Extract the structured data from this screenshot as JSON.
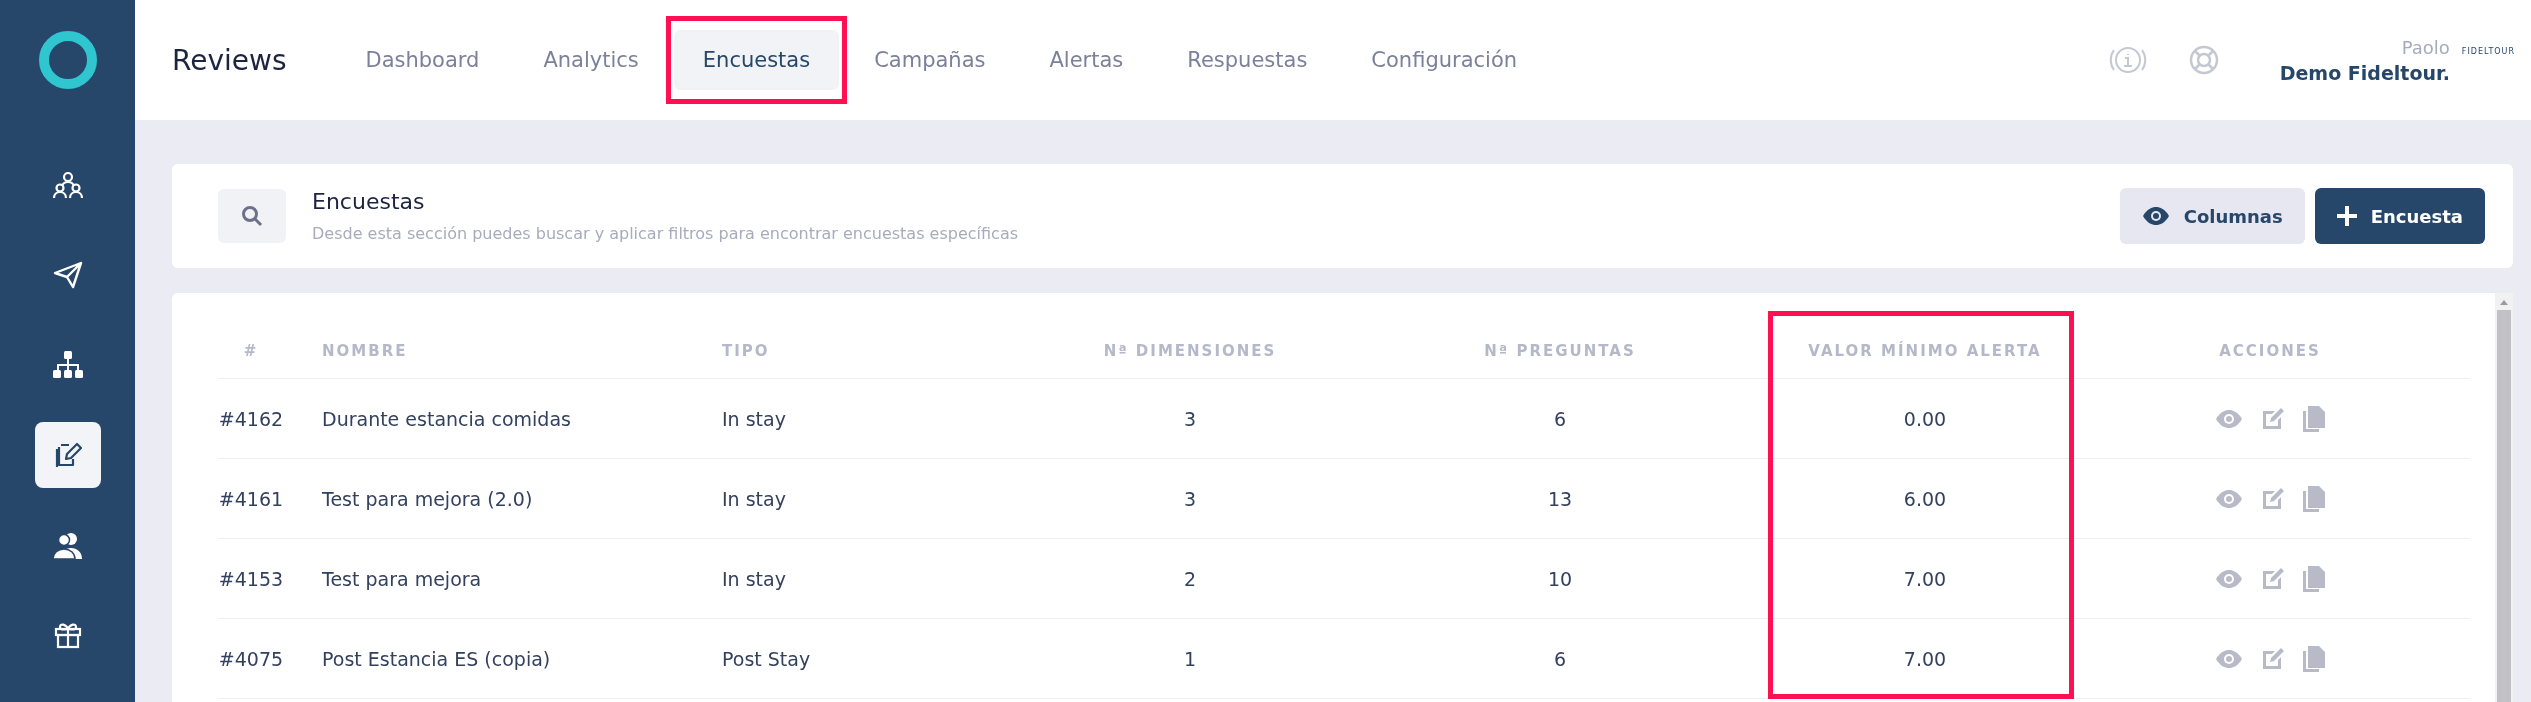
{
  "topbar": {
    "app_title": "Reviews",
    "nav": [
      {
        "label": "Dashboard",
        "selected": false,
        "highlighted": false
      },
      {
        "label": "Analytics",
        "selected": false,
        "highlighted": false
      },
      {
        "label": "Encuestas",
        "selected": true,
        "highlighted": true
      },
      {
        "label": "Campañas",
        "selected": false,
        "highlighted": false
      },
      {
        "label": "Alertas",
        "selected": false,
        "highlighted": false
      },
      {
        "label": "Respuestas",
        "selected": false,
        "highlighted": false
      },
      {
        "label": "Configuración",
        "selected": false,
        "highlighted": false
      }
    ],
    "user": {
      "name": "Paolo",
      "account": "Demo Fideltour.",
      "brand": "FIDELTOUR"
    }
  },
  "sidebar": {
    "items": [
      {
        "kind": "team",
        "selected": false
      },
      {
        "kind": "send",
        "selected": false
      },
      {
        "kind": "hierarchy",
        "selected": false
      },
      {
        "kind": "survey",
        "selected": true
      },
      {
        "kind": "users",
        "selected": false
      },
      {
        "kind": "gift",
        "selected": false
      }
    ]
  },
  "header": {
    "title": "Encuestas",
    "subtitle": "Desde esta sección puedes buscar y aplicar filtros para encontrar encuestas específicas",
    "buttons": [
      {
        "label": "Columnas",
        "kind": "secondary"
      },
      {
        "label": "Encuesta",
        "kind": "primary"
      }
    ]
  },
  "table": {
    "columns": [
      {
        "label": "#",
        "highlighted": false
      },
      {
        "label": "NOMBRE",
        "highlighted": false
      },
      {
        "label": "TIPO",
        "highlighted": false
      },
      {
        "label": "Nª DIMENSIONES",
        "highlighted": false
      },
      {
        "label": "Nª PREGUNTAS",
        "highlighted": false
      },
      {
        "label": "VALOR MÍNIMO ALERTA",
        "highlighted": true
      },
      {
        "label": "ACCIONES",
        "highlighted": false
      }
    ],
    "rows": [
      {
        "cells": [
          "#4162",
          "Durante estancia comidas",
          "In stay",
          "3",
          "6",
          "0.00"
        ]
      },
      {
        "cells": [
          "#4161",
          "Test para mejora (2.0)",
          "In stay",
          "3",
          "13",
          "6.00"
        ]
      },
      {
        "cells": [
          "#4153",
          "Test para mejora",
          "In stay",
          "2",
          "10",
          "7.00"
        ]
      },
      {
        "cells": [
          "#4075",
          "Post Estancia ES (copia)",
          "Post Stay",
          "1",
          "6",
          "7.00"
        ]
      }
    ]
  }
}
